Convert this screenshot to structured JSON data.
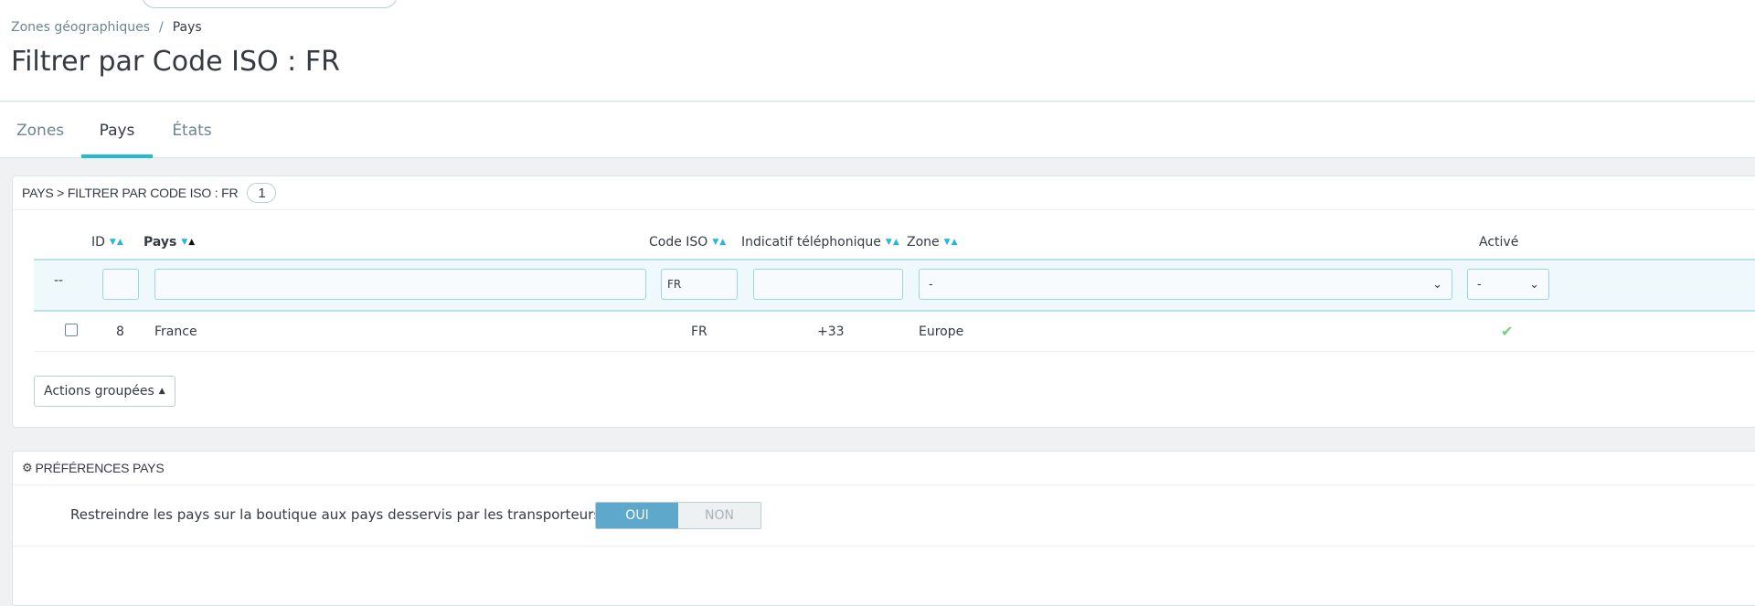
{
  "breadcrumb": {
    "parent": "Zones géographiques",
    "separator": "/",
    "current": "Pays"
  },
  "page_title": "Filtrer par Code ISO : FR",
  "tabs": [
    {
      "label": "Zones",
      "active": false
    },
    {
      "label": "Pays",
      "active": true
    },
    {
      "label": "États",
      "active": false
    }
  ],
  "list": {
    "heading": "PAYS > FILTRER PAR CODE ISO : FR",
    "count": "1",
    "columns": {
      "id": "ID",
      "country": "Pays",
      "iso": "Code ISO",
      "phone": "Indicatif téléphonique",
      "zone": "Zone",
      "active": "Activé"
    },
    "filters": {
      "dash": "--",
      "id": "",
      "country": "",
      "iso": "FR",
      "phone": "",
      "zone": "-",
      "active": "-"
    },
    "rows": [
      {
        "id": "8",
        "country": "France",
        "iso": "FR",
        "phone": "+33",
        "zone": "Europe",
        "active": "✔"
      }
    ],
    "bulk_actions_label": "Actions groupées"
  },
  "preferences": {
    "heading": "PRÉFÉRENCES PAYS",
    "restrict_label": "Restreindre les pays sur la boutique aux pays desservis par les transporteurs actifs",
    "toggle_on": "OUI",
    "toggle_off": "NON",
    "selected": "OUI"
  },
  "colors": {
    "accent": "#25b9d7",
    "toggle_on": "#5ea8cc",
    "check": "#78d07d"
  }
}
